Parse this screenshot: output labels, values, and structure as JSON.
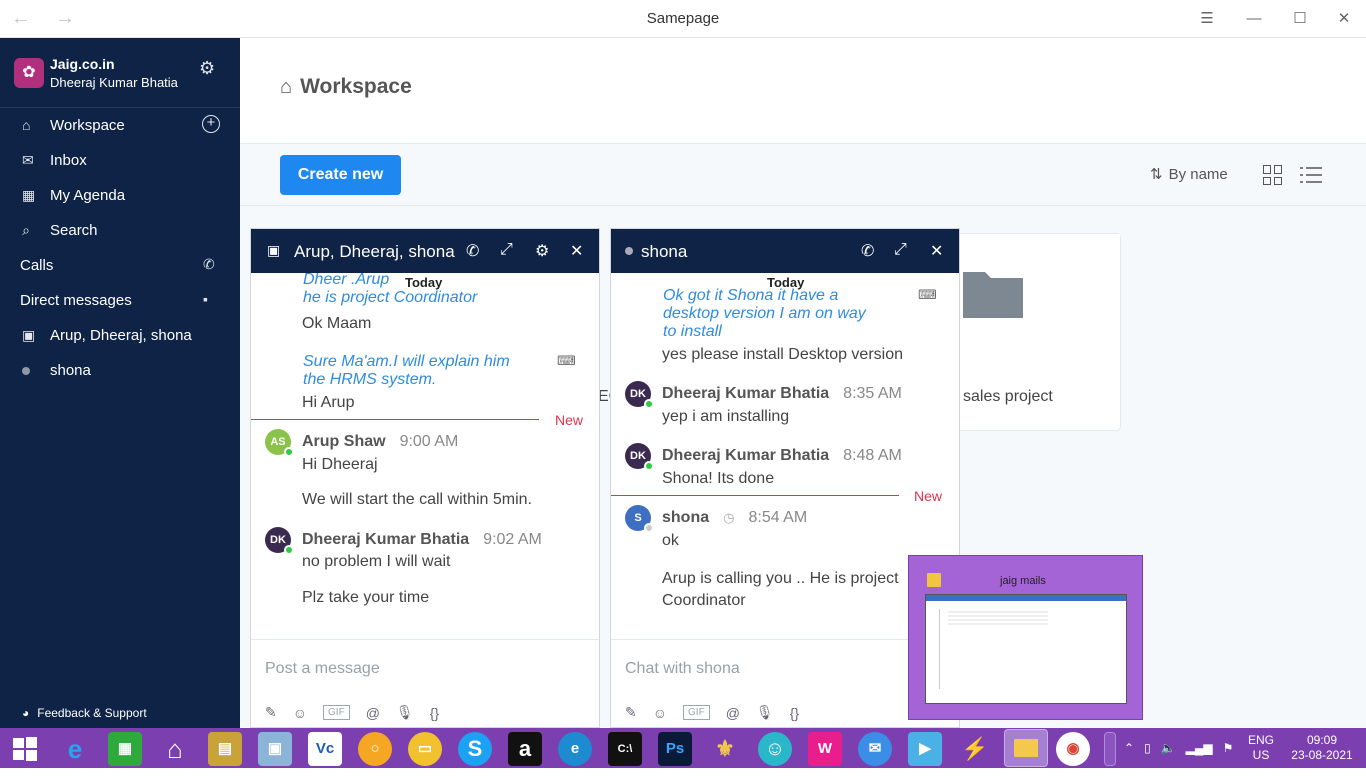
{
  "window": {
    "title": "Samepage"
  },
  "sidebar": {
    "org_name": "Jaig.co.in",
    "org_user": "Dheeraj Kumar Bhatia",
    "items": [
      {
        "label": "Workspace"
      },
      {
        "label": "Inbox"
      },
      {
        "label": "My Agenda"
      },
      {
        "label": "Search"
      }
    ],
    "calls_label": "Calls",
    "dm_label": "Direct messages",
    "dms": [
      {
        "label": "Arup, Dheeraj, shona"
      },
      {
        "label": "shona"
      }
    ],
    "feedback_label": "Feedback & Support"
  },
  "main": {
    "title": "Workspace",
    "create_label": "Create new",
    "sort_label": "By name",
    "card_label_2": "sales project",
    "card_label_1_fragment": "EC"
  },
  "chat1": {
    "title": "Arup, Dheeraj, shona",
    "today": "Today",
    "quote1_line1": "Dheer          .Arup",
    "quote1_line2": "he is project Coordinator",
    "msg1": "Ok Maam",
    "quote2_line1": "Sure Ma'am.I will explain him",
    "quote2_line2": "the HRMS system.",
    "msg2": "Hi Arup",
    "new_label": "New",
    "author1": "Arup Shaw",
    "time1": "9:00 AM",
    "msg3": "Hi Dheeraj",
    "msg4": "We will start the call within 5min.",
    "author2": "Dheeraj Kumar Bhatia",
    "time2": "9:02 AM",
    "msg5": "no problem I will wait",
    "msg6": "Plz take your time",
    "placeholder": "Post a message",
    "avatar1": "AS",
    "avatar2": "DK"
  },
  "chat2": {
    "title": "shona",
    "today": "Today",
    "quote1_line1": "Ok got it Shona it have a",
    "quote1_line2": "desktop version I am on way",
    "quote1_line3": "to install",
    "msg1": "yes please install Desktop version",
    "author1": "Dheeraj Kumar Bhatia",
    "time1": "8:35 AM",
    "msg2": "yep i am installing",
    "author2": "Dheeraj Kumar Bhatia",
    "time2": "8:48 AM",
    "msg3": "Shona! Its done",
    "new_label": "New",
    "author3": "shona",
    "time3": "8:54 AM",
    "msg4": "ok",
    "msg5_line1": "Arup is calling you .. He is project",
    "msg5_line2": "Coordinator",
    "placeholder": "Chat with shona",
    "avatar1": "DK",
    "avatar3": "S"
  },
  "popup": {
    "title": "jaig mails"
  },
  "compose_tools": {
    "gif": "GIF",
    "at": "@"
  },
  "tray": {
    "lang1": "ENG",
    "lang2": "US",
    "time": "09:09",
    "date": "23-08-2021"
  },
  "colors": {
    "sidebar": "#0e2345",
    "accent": "#1e88f0",
    "new": "#e0344f",
    "taskbar": "#7b3fb0",
    "quote": "#2f8be0"
  }
}
